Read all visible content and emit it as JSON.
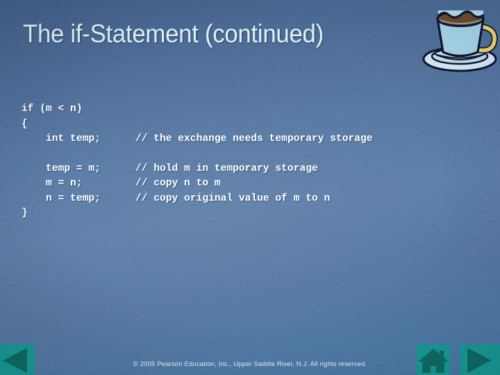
{
  "slide": {
    "title": "The if-Statement (continued)",
    "footer": "© 2005 Pearson Education, Inc., Upper Saddle River, N.J.  All rights reserved.",
    "colors": {
      "background_top": "#44608a",
      "background_mid": "#5e80ab",
      "background_bottom": "#4a77a6",
      "title_text": "#dff2f7",
      "code_text": "#ffffff",
      "footer_text": "#e8f2f8",
      "nav_button_fill": "#179b95",
      "nav_icon_fill": "#0d6b63",
      "cup_body": "#a9d8ea",
      "cup_coffee": "#6e4b28",
      "cup_handle": "#f5d76e",
      "cup_saucer": "#d8edf7"
    }
  },
  "code": {
    "lines": [
      {
        "text": "if (m < n)",
        "comment": "",
        "gap": false
      },
      {
        "text": "{",
        "comment": "",
        "gap": false
      },
      {
        "text": "    int temp;",
        "comment": "// the exchange needs temporary storage",
        "gap": false
      },
      {
        "text": "    temp = m;",
        "comment": "// hold m in temporary storage",
        "gap": true
      },
      {
        "text": "    m = n;",
        "comment": "// copy n to m",
        "gap": false
      },
      {
        "text": "    n = temp;",
        "comment": "// copy original value of m to n",
        "gap": false
      },
      {
        "text": "}",
        "comment": "",
        "gap": false
      }
    ]
  },
  "nav": {
    "previous": {
      "label": "Previous slide",
      "icon": "triangle-left-icon"
    },
    "home": {
      "label": "Home",
      "icon": "home-icon"
    },
    "next": {
      "label": "Next slide",
      "icon": "triangle-right-icon"
    }
  },
  "decoration": {
    "coffee_cup": "coffee-cup-icon"
  }
}
